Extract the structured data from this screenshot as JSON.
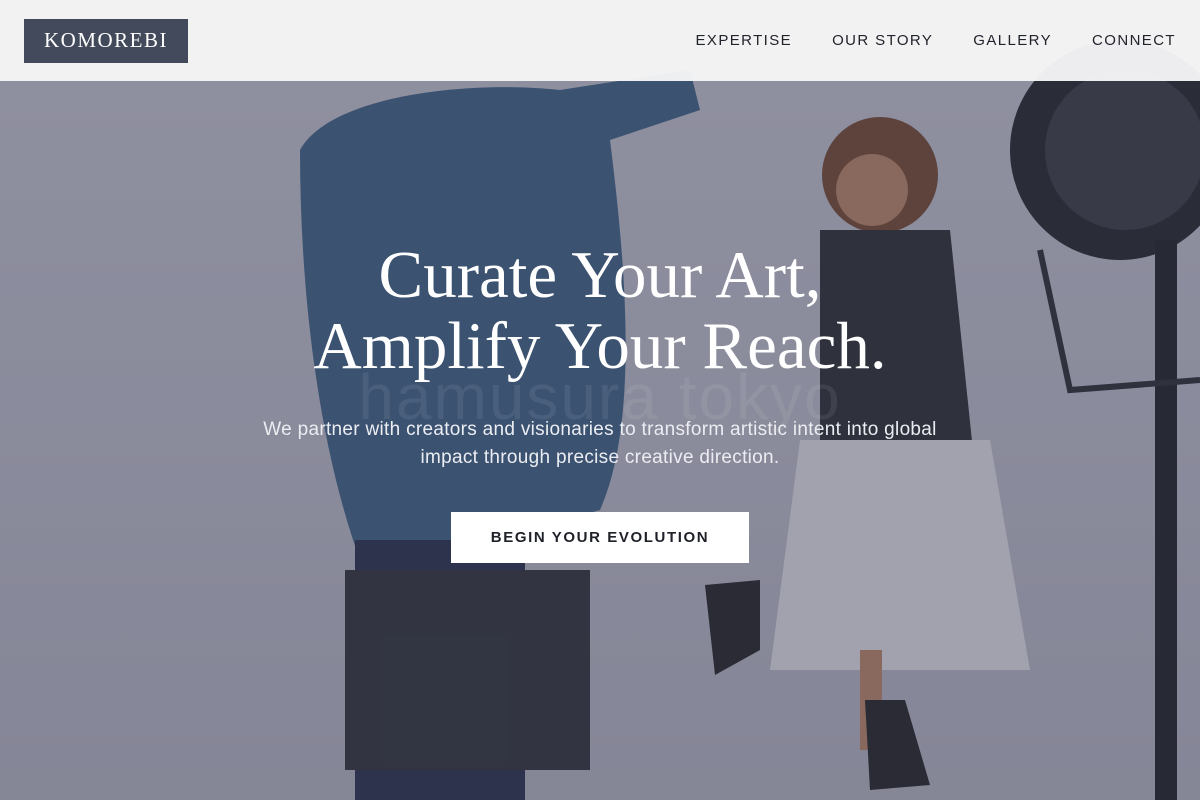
{
  "brand": {
    "logo_text": "KOMOREBI"
  },
  "nav": {
    "items": [
      {
        "label": "EXPERTISE"
      },
      {
        "label": "OUR STORY"
      },
      {
        "label": "GALLERY"
      },
      {
        "label": "CONNECT"
      }
    ]
  },
  "hero": {
    "headline_line1": "Curate Your Art,",
    "headline_line2": "Amplify Your Reach.",
    "subtitle": "We partner with creators and visionaries to transform artistic intent into global impact through precise creative direction.",
    "cta_label": "BEGIN YOUR EVOLUTION",
    "watermark": "hamusura tokyo"
  },
  "colors": {
    "logo_bg": "#434a5b",
    "header_bg": "#f6f6f7",
    "cta_bg": "#ffffff",
    "text_dark": "#1f2129"
  }
}
